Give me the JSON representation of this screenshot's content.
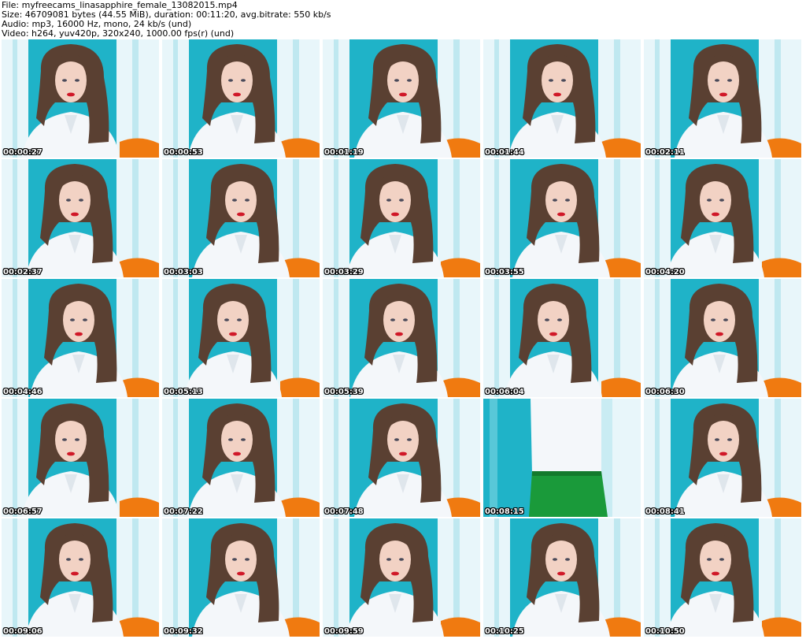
{
  "header": {
    "file_line": "File: myfreecams_linasapphire_female_13082015.mp4",
    "size_line": "Size: 46709081 bytes (44.55 MiB), duration: 00:11:20, avg.bitrate: 550 kb/s",
    "audio_line": "Audio: mp3, 16000 Hz, mono, 24 kb/s (und)",
    "video_line": "Video: h264, yuv420p, 320x240, 1000.00 fps(r) (und)"
  },
  "colors": {
    "wall": "#1fb3c8",
    "curtain": "#e8f6fa",
    "shirt": "#f4f7fa",
    "hair": "#5a4032",
    "skin": "#f2d2c4",
    "lips": "#d01828",
    "pillow": "#f07a10",
    "pants": "#1a9a3a"
  },
  "thumbnails": [
    {
      "timestamp": "00:00:27",
      "scene": "portrait"
    },
    {
      "timestamp": "00:00:53",
      "scene": "portrait"
    },
    {
      "timestamp": "00:01:19",
      "scene": "portrait"
    },
    {
      "timestamp": "00:01:44",
      "scene": "portrait"
    },
    {
      "timestamp": "00:02:11",
      "scene": "portrait"
    },
    {
      "timestamp": "00:02:37",
      "scene": "portrait"
    },
    {
      "timestamp": "00:03:03",
      "scene": "portrait"
    },
    {
      "timestamp": "00:03:29",
      "scene": "portrait"
    },
    {
      "timestamp": "00:03:55",
      "scene": "portrait"
    },
    {
      "timestamp": "00:04:20",
      "scene": "portrait"
    },
    {
      "timestamp": "00:04:46",
      "scene": "portrait"
    },
    {
      "timestamp": "00:05:13",
      "scene": "portrait"
    },
    {
      "timestamp": "00:05:39",
      "scene": "portrait"
    },
    {
      "timestamp": "00:06:04",
      "scene": "portrait"
    },
    {
      "timestamp": "00:06:30",
      "scene": "portrait"
    },
    {
      "timestamp": "00:06:57",
      "scene": "portrait"
    },
    {
      "timestamp": "00:07:22",
      "scene": "portrait"
    },
    {
      "timestamp": "00:07:48",
      "scene": "portrait"
    },
    {
      "timestamp": "00:08:15",
      "scene": "standing"
    },
    {
      "timestamp": "00:08:41",
      "scene": "portrait"
    },
    {
      "timestamp": "00:09:06",
      "scene": "portrait"
    },
    {
      "timestamp": "00:09:32",
      "scene": "portrait"
    },
    {
      "timestamp": "00:09:59",
      "scene": "portrait"
    },
    {
      "timestamp": "00:10:25",
      "scene": "portrait"
    },
    {
      "timestamp": "00:10:50",
      "scene": "portrait"
    }
  ]
}
